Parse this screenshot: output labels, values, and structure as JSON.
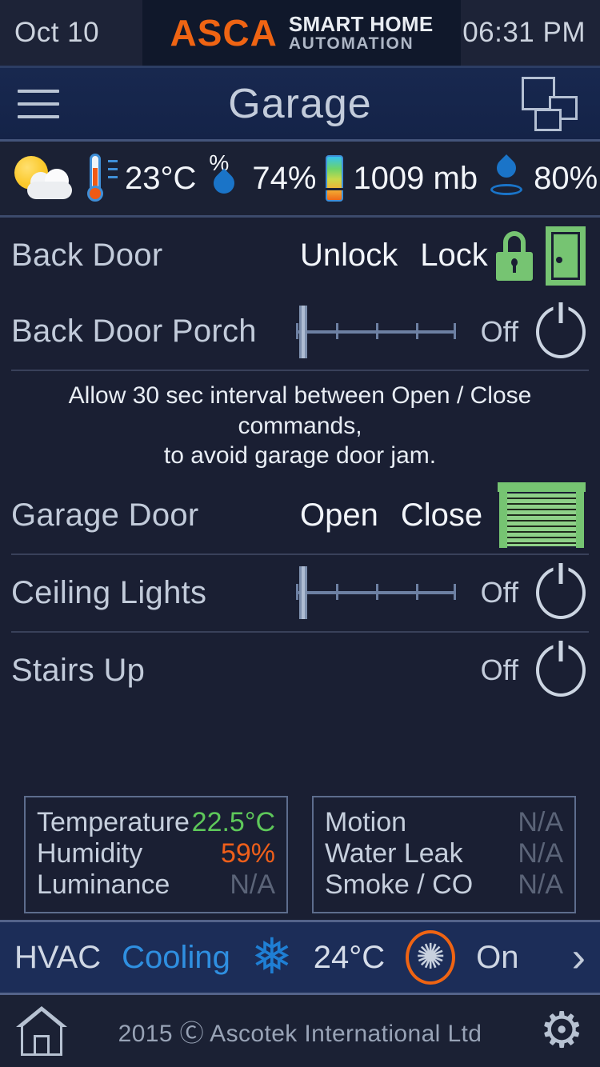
{
  "statusbar": {
    "date": "Oct 10",
    "time": "06:31 PM",
    "brand_main": "ASCA",
    "brand_line1": "SMART HOME",
    "brand_line2": "AUTOMATION"
  },
  "titlebar": {
    "title": "Garage"
  },
  "weather": {
    "condition_icon": "sun-behind-cloud-icon",
    "temperature": "23°C",
    "humidity": "74%",
    "pressure": "1009 mb",
    "rain_chance": "80%"
  },
  "devices": {
    "back_door": {
      "name": "Back Door",
      "cmd_primary": "Unlock",
      "cmd_secondary": "Lock",
      "lock_state_icon": "padlock-locked-icon",
      "door_state_icon": "door-closed-icon"
    },
    "back_door_porch": {
      "name": "Back Door Porch",
      "state": "Off",
      "dim_level": 0
    },
    "garage_note_line1": "Allow 30 sec  interval between Open / Close commands,",
    "garage_note_line2": "to avoid garage door jam.",
    "garage_door": {
      "name": "Garage Door",
      "cmd_primary": "Open",
      "cmd_secondary": "Close",
      "door_state_icon": "garage-door-closed-icon"
    },
    "ceiling_lights": {
      "name": "Ceiling Lights",
      "state": "Off",
      "dim_level": 0
    },
    "stairs_up": {
      "name": "Stairs Up",
      "state": "Off"
    }
  },
  "sensors": {
    "left": [
      {
        "label": "Temperature",
        "value": "22.5°C",
        "tone": "green"
      },
      {
        "label": "Humidity",
        "value": "59%",
        "tone": "orange"
      },
      {
        "label": "Luminance",
        "value": "N/A",
        "tone": "na"
      }
    ],
    "right": [
      {
        "label": "Motion",
        "value": "N/A",
        "tone": "na"
      },
      {
        "label": "Water Leak",
        "value": "N/A",
        "tone": "na"
      },
      {
        "label": "Smoke / CO",
        "value": "N/A",
        "tone": "na"
      }
    ]
  },
  "hvac": {
    "label": "HVAC",
    "mode": "Cooling",
    "mode_icon": "snowflake-icon",
    "setpoint": "24°C",
    "fan_icon": "fan-icon",
    "fan_state": "On",
    "chevron": "›"
  },
  "footer": {
    "home_icon": "home-icon",
    "copyright": "2015 Ⓒ Ascotek International Ltd",
    "settings_icon": "gear-icon"
  },
  "colors": {
    "background": "#1a1f33",
    "accent_orange": "#ef6413",
    "accent_blue": "#2f8fe0",
    "green_status": "#76c472",
    "text_primary": "#c3ccdb"
  }
}
